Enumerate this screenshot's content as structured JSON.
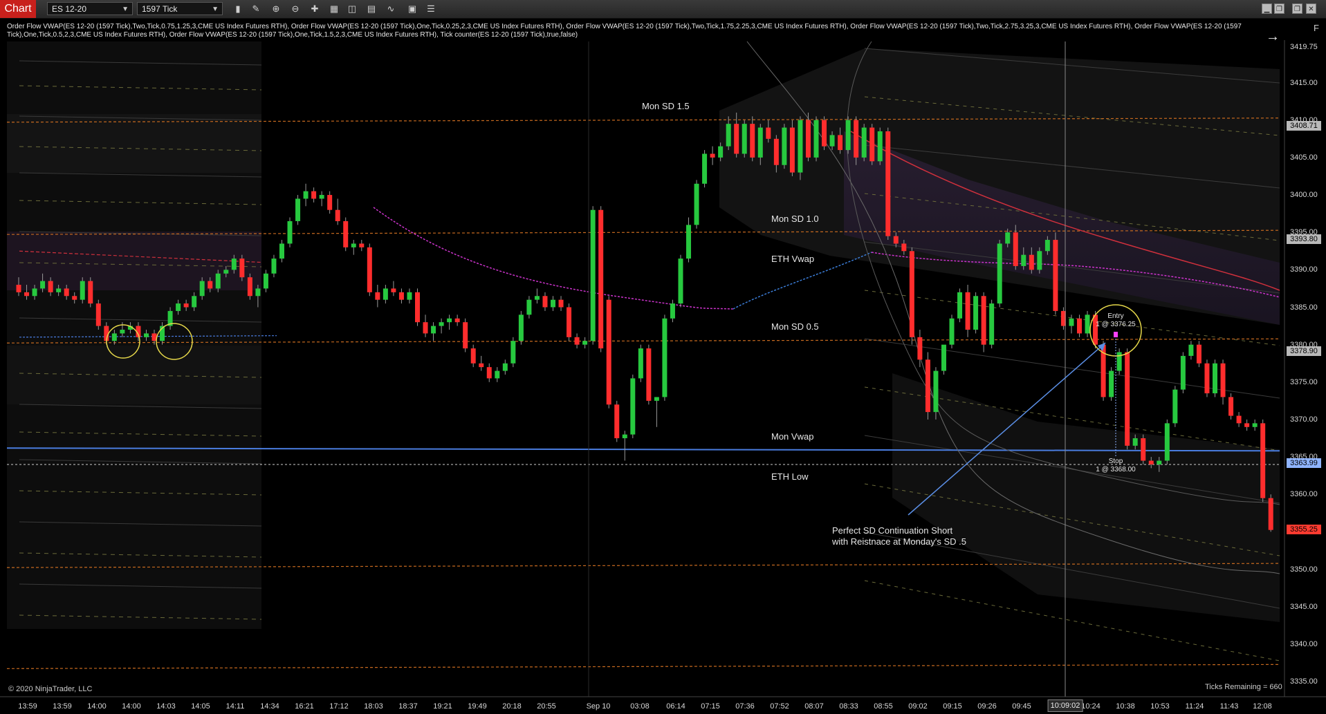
{
  "window": {
    "tab_label": "Chart",
    "instrument": "ES 12-20",
    "interval": "1597 Tick",
    "window_buttons": [
      "▁",
      "❐",
      "❐",
      "✕"
    ]
  },
  "indicators_text": "Order Flow VWAP(ES 12-20 (1597 Tick),Two,Tick,0.75,1.25,3,CME US Index Futures RTH), Order Flow VWAP(ES 12-20 (1597 Tick),One,Tick,0.25,2,3,CME US Index Futures RTH), Order Flow VWAP(ES 12-20 (1597 Tick),Two,Tick,1.75,2.25,3,CME US Index Futures RTH), Order Flow VWAP(ES 12-20 (1597 Tick),Two,Tick,2.75,3.25,3,CME US Index Futures RTH), Order Flow VWAP(ES 12-20 (1597 Tick),One,Tick,0.5,2,3,CME US Index Futures RTH), Order Flow VWAP(ES 12-20 (1597 Tick),One,Tick,1.5,2,3,CME US Index Futures RTH), Tick counter(ES 12-20 (1597 Tick),true,false)",
  "panel_button": "F",
  "annotations": {
    "mon_sd_15": "Mon SD 1.5",
    "mon_sd_10": "Mon SD 1.0",
    "eth_vwap": "ETH Vwap",
    "mon_sd_05": "Mon SD 0.5",
    "mon_vwap": "Mon Vwap",
    "eth_low": "ETH Low",
    "entry_title": "Entry",
    "entry_detail": "1 @ 3376.25",
    "stop_title": "Stop",
    "stop_detail": "1 @ 3368.00",
    "note_line1": "Perfect SD Continuation Short",
    "note_line2": "with Reistnace at Monday's SD .5"
  },
  "footer": {
    "copyright": "© 2020 NinjaTrader, LLC",
    "ticks_remaining": "Ticks Remaining = 660",
    "crosshair_time": "10:09:02"
  },
  "price_axis": {
    "ticks": [
      "3419.75",
      "3415.00",
      "3410.00",
      "3405.00",
      "3400.00",
      "3395.00",
      "3390.00",
      "3385.00",
      "3380.00",
      "3375.00",
      "3370.00",
      "3365.00",
      "3360.00",
      "3355.00",
      "3350.00",
      "3345.00",
      "3340.00",
      "3335.00"
    ],
    "marker_3408": "3408.71",
    "marker_3393": "3393.80",
    "marker_3378": "3378.90",
    "marker_3363": "3363.99",
    "marker_3355": "3355.25",
    "marker_colors": {
      "grey": "#b9b9b9",
      "blue": "#8fb4ff",
      "red": "#ff3b30"
    }
  },
  "time_axis": {
    "labels": [
      "13:59",
      "13:59",
      "14:00",
      "14:00",
      "14:03",
      "14:05",
      "14:11",
      "14:34",
      "16:21",
      "17:12",
      "18:03",
      "18:37",
      "19:21",
      "19:49",
      "20:18",
      "20:55",
      "Sep 10",
      "03:08",
      "06:14",
      "07:15",
      "07:36",
      "07:52",
      "08:07",
      "08:33",
      "08:55",
      "09:02",
      "09:15",
      "09:26",
      "09:45",
      "10:24",
      "10:38",
      "10:53",
      "11:24",
      "11:43",
      "12:08"
    ]
  },
  "chart_data": {
    "type": "candlestick",
    "y_axis_range": [
      3333,
      3421
    ],
    "up_color": "#27c93f",
    "down_color": "#ff2d2d",
    "candles": [
      [
        3388,
        3389,
        3386.5,
        3387
      ],
      [
        3387,
        3388,
        3386,
        3386.5
      ],
      [
        3386.5,
        3388,
        3386,
        3387.5
      ],
      [
        3387.5,
        3389.5,
        3387,
        3388.5
      ],
      [
        3388.5,
        3389,
        3386.5,
        3387
      ],
      [
        3387,
        3388,
        3386.5,
        3387.5
      ],
      [
        3387.5,
        3388,
        3386,
        3386.5
      ],
      [
        3386.5,
        3387,
        3385.5,
        3386
      ],
      [
        3386,
        3389,
        3385.5,
        3388.5
      ],
      [
        3388.5,
        3389,
        3385,
        3385.5
      ],
      [
        3385.5,
        3386,
        3382,
        3382.5
      ],
      [
        3382.5,
        3383,
        3380,
        3380.5
      ],
      [
        3380.5,
        3382,
        3380,
        3381.5
      ],
      [
        3381.5,
        3383,
        3381,
        3382
      ],
      [
        3382,
        3383,
        3381.5,
        3382.5
      ],
      [
        3382.5,
        3383,
        3380.5,
        3381
      ],
      [
        3381,
        3382,
        3380.5,
        3381.5
      ],
      [
        3381.5,
        3382,
        3380,
        3380.5
      ],
      [
        3380.5,
        3383,
        3380,
        3382.5
      ],
      [
        3382.5,
        3385,
        3382,
        3384.5
      ],
      [
        3384.5,
        3386,
        3384,
        3385.5
      ],
      [
        3385.5,
        3386,
        3384.5,
        3385
      ],
      [
        3385,
        3387,
        3384.5,
        3386.5
      ],
      [
        3386.5,
        3389,
        3386,
        3388.5
      ],
      [
        3388.5,
        3389,
        3387,
        3387.5
      ],
      [
        3387.5,
        3390,
        3387,
        3389.5
      ],
      [
        3389.5,
        3390.5,
        3389,
        3390
      ],
      [
        3390,
        3392,
        3389.5,
        3391.5
      ],
      [
        3391.5,
        3392,
        3388.5,
        3389
      ],
      [
        3389,
        3389.5,
        3386,
        3386.5
      ],
      [
        3386.5,
        3388,
        3385,
        3387.5
      ],
      [
        3387.5,
        3390,
        3387,
        3389.5
      ],
      [
        3389.5,
        3392,
        3389,
        3391.5
      ],
      [
        3391.5,
        3394,
        3391,
        3393.5
      ],
      [
        3393.5,
        3397,
        3393,
        3396.5
      ],
      [
        3396.5,
        3400,
        3396,
        3399.5
      ],
      [
        3399.5,
        3401.5,
        3398.5,
        3400.5
      ],
      [
        3400.5,
        3401,
        3399,
        3399.5
      ],
      [
        3399.5,
        3400.5,
        3398.5,
        3400
      ],
      [
        3400,
        3400.5,
        3397.5,
        3398
      ],
      [
        3398,
        3399.5,
        3396,
        3396.5
      ],
      [
        3396.5,
        3397,
        3392.5,
        3393
      ],
      [
        3393,
        3394,
        3392,
        3393.5
      ],
      [
        3393.5,
        3394,
        3392.5,
        3393
      ],
      [
        3393,
        3393.5,
        3386.5,
        3387
      ],
      [
        3387,
        3388,
        3385,
        3386
      ],
      [
        3386,
        3388,
        3385.5,
        3387.5
      ],
      [
        3387.5,
        3388.5,
        3386.5,
        3387
      ],
      [
        3387,
        3387.5,
        3385.5,
        3386
      ],
      [
        3386,
        3387.5,
        3385.5,
        3387
      ],
      [
        3387,
        3387.5,
        3382.5,
        3383
      ],
      [
        3383,
        3384,
        3381,
        3381.5
      ],
      [
        3381.5,
        3383,
        3380.5,
        3382.5
      ],
      [
        3382.5,
        3383.5,
        3381.5,
        3383
      ],
      [
        3383,
        3384,
        3382,
        3383.5
      ],
      [
        3383.5,
        3384,
        3382.5,
        3383
      ],
      [
        3383,
        3383.5,
        3379,
        3379.5
      ],
      [
        3379.5,
        3380,
        3377,
        3377.5
      ],
      [
        3377.5,
        3378.5,
        3376.5,
        3377
      ],
      [
        3377,
        3377.5,
        3375,
        3375.5
      ],
      [
        3375.5,
        3377,
        3375,
        3376.5
      ],
      [
        3376.5,
        3378,
        3376,
        3377.5
      ],
      [
        3377.5,
        3381,
        3377,
        3380.5
      ],
      [
        3380.5,
        3384.5,
        3380,
        3384
      ],
      [
        3384,
        3386.5,
        3383.5,
        3386
      ],
      [
        3386,
        3387.5,
        3385.5,
        3386.5
      ],
      [
        3386.5,
        3387,
        3384.5,
        3385
      ],
      [
        3385,
        3386.5,
        3384.5,
        3386
      ],
      [
        3386,
        3386.5,
        3384.5,
        3385
      ],
      [
        3385,
        3385.5,
        3380.5,
        3381
      ],
      [
        3381,
        3381.5,
        3379.5,
        3380
      ],
      [
        3380,
        3381,
        3379.5,
        3380.5
      ],
      [
        3380.5,
        3398.5,
        3380,
        3398
      ],
      [
        3398,
        3398.5,
        3379,
        3379.5
      ],
      [
        3386,
        3386.5,
        3371.5,
        3372
      ],
      [
        3372,
        3372.5,
        3367,
        3367.5
      ],
      [
        3367.5,
        3368.5,
        3364.5,
        3368
      ],
      [
        3368,
        3376,
        3367.5,
        3375.5
      ],
      [
        3375.5,
        3380,
        3375,
        3379.5
      ],
      [
        3379.5,
        3380,
        3372,
        3372.5
      ],
      [
        3372.5,
        3373,
        3369,
        3373
      ],
      [
        3373,
        3384,
        3372.5,
        3383.5
      ],
      [
        3383.5,
        3386,
        3383,
        3385.5
      ],
      [
        3385.5,
        3392,
        3385,
        3391.5
      ],
      [
        3391.5,
        3397,
        3391,
        3396
      ],
      [
        3396,
        3402,
        3395.5,
        3401.5
      ],
      [
        3401.5,
        3406,
        3401,
        3405.5
      ],
      [
        3405.5,
        3406.5,
        3404,
        3405
      ],
      [
        3405,
        3407,
        3404.5,
        3406.5
      ],
      [
        3406.5,
        3410.5,
        3406,
        3409.5
      ],
      [
        3409.5,
        3411,
        3405,
        3405.5
      ],
      [
        3405.5,
        3410,
        3405,
        3409.5
      ],
      [
        3409.5,
        3410.5,
        3404.5,
        3405
      ],
      [
        3405,
        3409.5,
        3404,
        3409
      ],
      [
        3409,
        3410,
        3407,
        3407.5
      ],
      [
        3407.5,
        3408,
        3403,
        3404
      ],
      [
        3404,
        3409.5,
        3403.5,
        3409
      ],
      [
        3409,
        3410,
        3402.5,
        3403
      ],
      [
        3403,
        3410.5,
        3402,
        3410
      ],
      [
        3410,
        3411,
        3404.5,
        3405
      ],
      [
        3405,
        3410.5,
        3404.5,
        3410
      ],
      [
        3410,
        3410.5,
        3406,
        3406.5
      ],
      [
        3406.5,
        3408.5,
        3406,
        3408
      ],
      [
        3408,
        3409,
        3405.5,
        3406
      ],
      [
        3406,
        3410.5,
        3405.5,
        3410
      ],
      [
        3410,
        3410.5,
        3404,
        3405
      ],
      [
        3405,
        3409.5,
        3404.5,
        3409
      ],
      [
        3409,
        3409.5,
        3404,
        3404.5
      ],
      [
        3404.5,
        3409,
        3404,
        3408.5
      ],
      [
        3408.5,
        3409,
        3394,
        3394.5
      ],
      [
        3394.5,
        3395,
        3393,
        3393.5
      ],
      [
        3393.5,
        3394,
        3392,
        3392.5
      ],
      [
        3392.5,
        3393,
        3380,
        3381
      ],
      [
        3381,
        3382,
        3377,
        3378
      ],
      [
        3378,
        3379,
        3370,
        3371
      ],
      [
        3371,
        3377,
        3370,
        3376.5
      ],
      [
        3376.5,
        3377,
        3376,
        3380
      ],
      [
        3380,
        3384,
        3379.5,
        3383.5
      ],
      [
        3383.5,
        3387.5,
        3383,
        3387
      ],
      [
        3387,
        3388,
        3381,
        3382
      ],
      [
        3382,
        3387,
        3381.5,
        3386.5
      ],
      [
        3386.5,
        3387,
        3379,
        3380
      ],
      [
        3380,
        3386,
        3379.5,
        3385.5
      ],
      [
        3385.5,
        3394,
        3385,
        3393.5
      ],
      [
        3393.5,
        3395.5,
        3393,
        3395
      ],
      [
        3395,
        3396,
        3390,
        3390.5
      ],
      [
        3390.5,
        3393,
        3390,
        3392
      ],
      [
        3392,
        3393,
        3389.5,
        3390
      ],
      [
        3390,
        3393,
        3389.5,
        3392.5
      ],
      [
        3392.5,
        3394.5,
        3392,
        3394
      ],
      [
        3394,
        3395,
        3384,
        3384.5
      ],
      [
        3384.5,
        3385,
        3382,
        3382.5
      ],
      [
        3382.5,
        3384,
        3381.5,
        3383.5
      ],
      [
        3383.5,
        3384,
        3381,
        3381.5
      ],
      [
        3381.5,
        3384.5,
        3381,
        3384
      ],
      [
        3384,
        3384.5,
        3379.5,
        3380
      ],
      [
        3380,
        3380.5,
        3372.5,
        3373
      ],
      [
        3373,
        3377,
        3372.5,
        3376.5
      ],
      [
        3376.5,
        3379.5,
        3376,
        3379
      ],
      [
        3379,
        3379.5,
        3366,
        3366.5
      ],
      [
        3366.5,
        3368,
        3366,
        3367.5
      ],
      [
        3367.5,
        3368,
        3364,
        3364.5
      ],
      [
        3364.5,
        3365,
        3363.5,
        3364
      ],
      [
        3364,
        3365,
        3363,
        3364.5
      ],
      [
        3364.5,
        3370,
        3364,
        3369.5
      ],
      [
        3369.5,
        3374.5,
        3369,
        3374
      ],
      [
        3374,
        3379,
        3373.5,
        3378.5
      ],
      [
        3378.5,
        3380.5,
        3378,
        3380
      ],
      [
        3380,
        3380.5,
        3377,
        3377.5
      ],
      [
        3377.5,
        3378,
        3373,
        3373.5
      ],
      [
        3373.5,
        3378,
        3373,
        3377.5
      ],
      [
        3377.5,
        3378,
        3372,
        3373
      ],
      [
        3373,
        3373.5,
        3370,
        3370.5
      ],
      [
        3370.5,
        3371,
        3369,
        3369.5
      ],
      [
        3369.5,
        3370,
        3368.5,
        3369
      ],
      [
        3369,
        3370,
        3368.5,
        3369.5
      ],
      [
        3369.5,
        3370,
        3359,
        3359.5
      ],
      [
        3359.5,
        3360,
        3355,
        3355.25
      ]
    ],
    "reference_levels": {
      "mon_sd_15": 3410.0,
      "mon_sd_10": 3395.0,
      "mon_sd_05": 3380.5,
      "mon_vwap": 3366.0,
      "eth_low": 3363.99,
      "upper_orange": 3350.5,
      "lower_orange": 3337.0
    },
    "entry_price": 3376.25,
    "stop_price": 3368.0
  }
}
